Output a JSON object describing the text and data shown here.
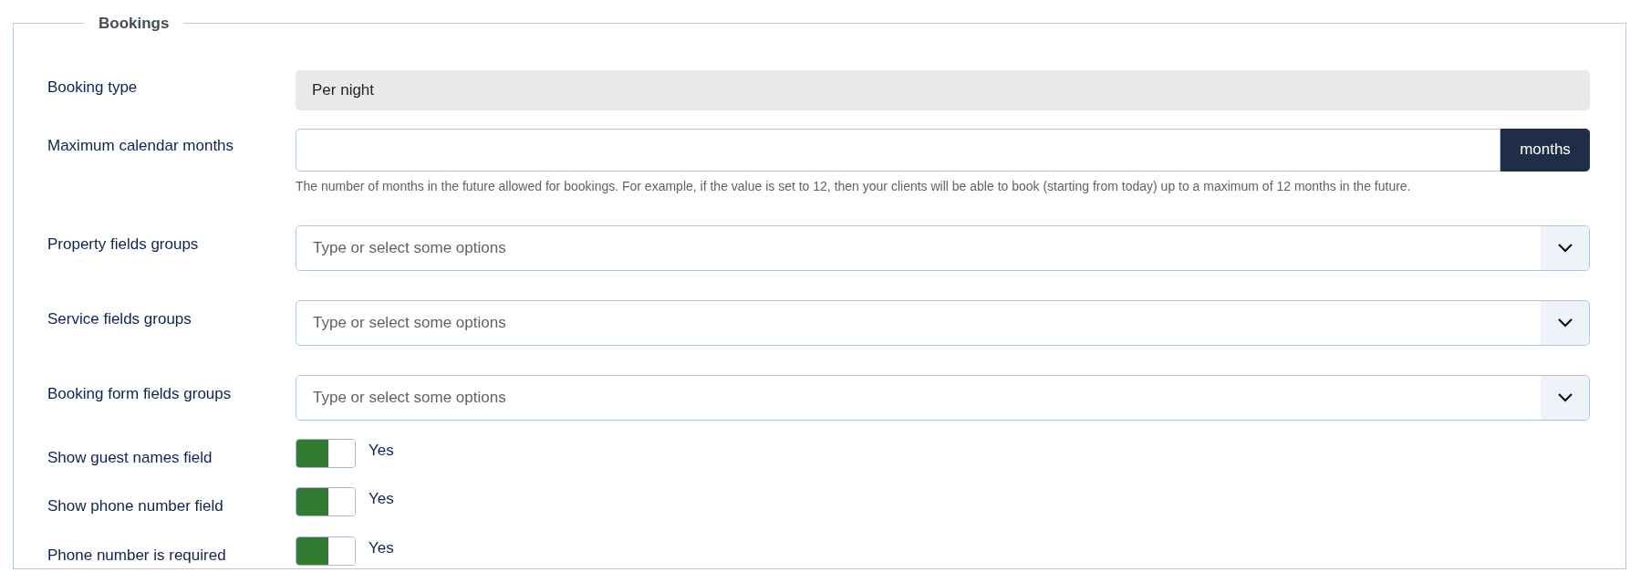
{
  "fieldset": {
    "legend": "Bookings",
    "fields": [
      {
        "kind": "readonly",
        "label": "Booking type",
        "value": "Per night"
      },
      {
        "kind": "addon",
        "label": "Maximum calendar months",
        "addon": "months",
        "help": "The number of months in the future allowed for bookings. For example, if the value is set to 12, then your clients will be able to book (starting from today) up to a maximum of 12 months in the future."
      },
      {
        "kind": "select",
        "label": "Property fields groups",
        "placeholder": "Type or select some options"
      },
      {
        "kind": "select",
        "label": "Service fields groups",
        "placeholder": "Type or select some options"
      },
      {
        "kind": "select",
        "label": "Booking form fields groups",
        "placeholder": "Type or select some options"
      },
      {
        "kind": "toggle",
        "label": "Show guest names field",
        "on": true,
        "state_label": "Yes"
      },
      {
        "kind": "toggle",
        "label": "Show phone number field",
        "on": true,
        "state_label": "Yes"
      },
      {
        "kind": "toggle",
        "label": "Phone number is required",
        "on": true,
        "state_label": "Yes"
      }
    ]
  }
}
